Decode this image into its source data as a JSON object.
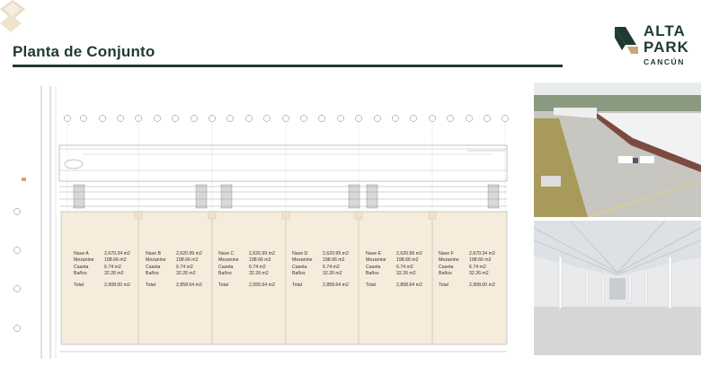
{
  "header": {
    "title": "Planta de Conjunto"
  },
  "logo": {
    "line1": "ALTA",
    "line2": "PARK",
    "line3": "CANCÚN"
  },
  "naves": [
    {
      "name": "Nave A",
      "area": "2,670.34 m2",
      "mezz_label": "Mezanine",
      "mezz": "198.66 m2",
      "caseta_label": "Caseta",
      "caseta": "6.74 m2",
      "banos_label": "Baños",
      "banos": "32.26 m2",
      "total_label": "Total",
      "total": "2,908.00 m2"
    },
    {
      "name": "Nave B",
      "area": "2,620.99 m2",
      "mezz_label": "Mezanine",
      "mezz": "198.66 m2",
      "caseta_label": "Caseta",
      "caseta": "6.74 m2",
      "banos_label": "Baños",
      "banos": "32.26 m2",
      "total_label": "Total",
      "total": "2,858.64 m2"
    },
    {
      "name": "Nave C",
      "area": "2,620.99 m2",
      "mezz_label": "Mezanine",
      "mezz": "198.66 m2",
      "caseta_label": "Caseta",
      "caseta": "6.74 m2",
      "banos_label": "Baños",
      "banos": "32.26 m2",
      "total_label": "Total",
      "total": "2,555.64 m2"
    },
    {
      "name": "Nave D",
      "area": "2,620.99 m2",
      "mezz_label": "Mezanine",
      "mezz": "198.66 m2",
      "caseta_label": "Caseta",
      "caseta": "6.74 m2",
      "banos_label": "Baños",
      "banos": "32.26 m2",
      "total_label": "Total",
      "total": "2,858.64 m2"
    },
    {
      "name": "Nave E",
      "area": "2,620.99 m2",
      "mezz_label": "Mezanine",
      "mezz": "198.66 m2",
      "caseta_label": "Caseta",
      "caseta": "6.74 m2",
      "banos_label": "Baños",
      "banos": "32.26 m2",
      "total_label": "Total",
      "total": "2,858.64 m2"
    },
    {
      "name": "Nave F",
      "area": "2,670.34 m2",
      "mezz_label": "Mezanine",
      "mezz": "198.66 m2",
      "caseta_label": "Caseta",
      "caseta": "6.74 m2",
      "banos_label": "Baños",
      "banos": "32.26 m2",
      "total_label": "Total",
      "total": "2,908.00 m2"
    }
  ],
  "colors": {
    "brand_dark": "#1f3a34",
    "brand_gold": "#c9a874",
    "plan_fill": "#f6ecdc"
  }
}
